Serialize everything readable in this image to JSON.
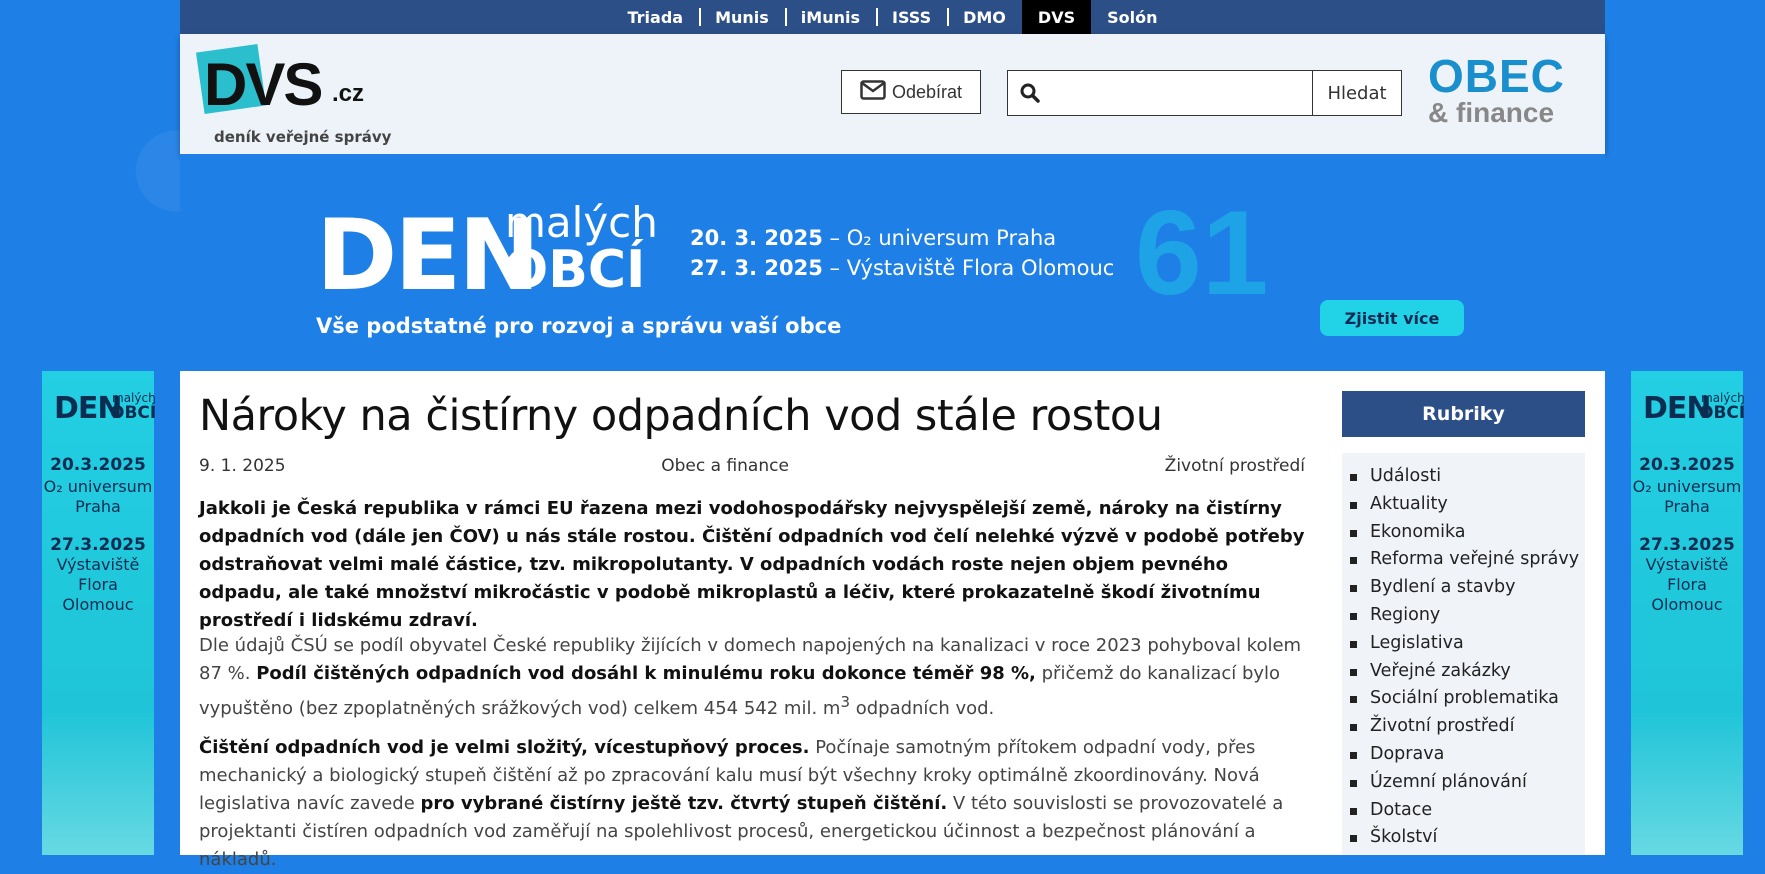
{
  "topnav": {
    "items": [
      "Triada",
      "Munis",
      "iMunis",
      "ISSS",
      "DMO",
      "DVS",
      "Solón"
    ],
    "active": "DVS"
  },
  "header": {
    "logo_main": "DVS",
    "logo_suffix": ".cz",
    "logo_tagline": "deník veřejné správy",
    "subscribe_label": "Odebírat",
    "search_placeholder": "",
    "search_button": "Hledat",
    "partner_line1": "OBEC",
    "partner_line2": "& finance"
  },
  "banner": {
    "den": "DEN",
    "malych": "malých",
    "obci": "OBCÍ",
    "date1": "20. 3. 2025",
    "place1": " – O₂ universum Praha",
    "date2": "27. 3. 2025",
    "place2": " – Výstaviště Flora Olomouc",
    "tagline": "Vše podstatné pro rozvoj a správu vaší obce",
    "number": "61",
    "cta": "Zjistit více"
  },
  "side_ad": {
    "den": "DEN",
    "malych": "malých",
    "obci": "OBCÍ",
    "date1": "20.3.2025",
    "place1_a": "O₂ universum",
    "place1_b": "Praha",
    "date2": "27.3.2025",
    "place2_a": "Výstaviště",
    "place2_b": "Flora",
    "place2_c": "Olomouc"
  },
  "article": {
    "title": "Nároky na čistírny odpadních vod stále rostou",
    "date": "9. 1. 2025",
    "source": "Obec a finance",
    "category": "Životní prostředí",
    "lead": "Jakkoli je Česká republika v rámci EU řazena mezi vodohospodářsky nejvyspělejší země, nároky na čistírny odpadních vod (dále jen ČOV) u nás stále rostou. Čištění odpadních vod čelí nelehké výzvě v podobě potřeby odstraňovat velmi malé částice, tzv. mikropolutanty. V odpadních vodách roste nejen objem pevného odpadu, ale také množství mikročástic v podobě mikroplastů a léčiv, které prokazatelně škodí životnímu prostředí i lidskému zdraví.",
    "p1_a": "Dle údajů ČSÚ se podíl obyvatel České republiky žijících v domech napojených na kanalizaci v roce 2023 pohyboval kolem 87 %. ",
    "p1_b": "Podíl čištěných odpadních vod dosáhl k minulému roku dokonce téměř 98 %,",
    "p1_c": " přičemž do kanalizací bylo vypuštěno (bez zpoplatněných srážkových vod) celkem 454 542 mil. m",
    "p1_sup": "3",
    "p1_d": " odpadních vod.",
    "p2_a": "Čištění odpadních vod je velmi složitý, vícestupňový proces.",
    "p2_b": " Počínaje samotným přítokem odpadní vody, přes mechanický a biologický stupeň čištění až po zpracování kalu musí být všechny kroky optimálně zkoordinovány. Nová legislativa navíc zavede ",
    "p2_c": "pro vybrané čistírny ještě tzv. čtvrtý stupeň čištění.",
    "p2_d": " V této souvislosti se provozovatelé a projektanti čistíren odpadních vod zaměřují na spolehlivost procesů, energetickou účinnost a bezpečnost plánování a nákladů."
  },
  "rubriky": {
    "heading": "Rubriky",
    "items": [
      "Události",
      "Aktuality",
      "Ekonomika",
      "Reforma veřejné správy",
      "Bydlení a stavby",
      "Regiony",
      "Legislativa",
      "Veřejné zakázky",
      "Sociální problematika",
      "Životní prostředí",
      "Doprava",
      "Územní plánování",
      "Dotace",
      "Školství"
    ]
  }
}
